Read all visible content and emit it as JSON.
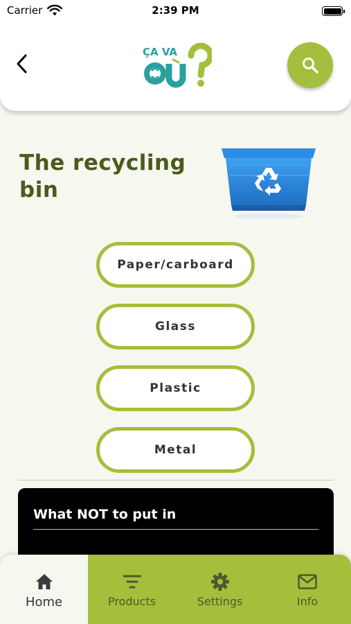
{
  "status_bar": {
    "carrier": "Carrier",
    "time": "2:39 PM"
  },
  "header": {
    "back_icon": "chevron-left-icon",
    "logo_text_top": "ÇA VA",
    "logo_text_bottom": "OÙ",
    "search_icon": "search-icon"
  },
  "main": {
    "title": "The recycling bin",
    "categories": [
      {
        "label": "Paper/carboard"
      },
      {
        "label": "Glass"
      },
      {
        "label": "Plastic"
      },
      {
        "label": "Metal"
      }
    ],
    "not_panel_title": "What NOT to put in"
  },
  "bottom_nav": {
    "items": [
      {
        "label": "Home",
        "icon": "home-icon",
        "active": true
      },
      {
        "label": "Products",
        "icon": "filter-icon",
        "active": false
      },
      {
        "label": "Settings",
        "icon": "gear-icon",
        "active": false
      },
      {
        "label": "Info",
        "icon": "mail-icon",
        "active": false
      }
    ]
  },
  "colors": {
    "accent": "#a3bf3b",
    "title": "#4a5a1c",
    "background": "#f6f7ef",
    "bin": "#2a8be0"
  }
}
